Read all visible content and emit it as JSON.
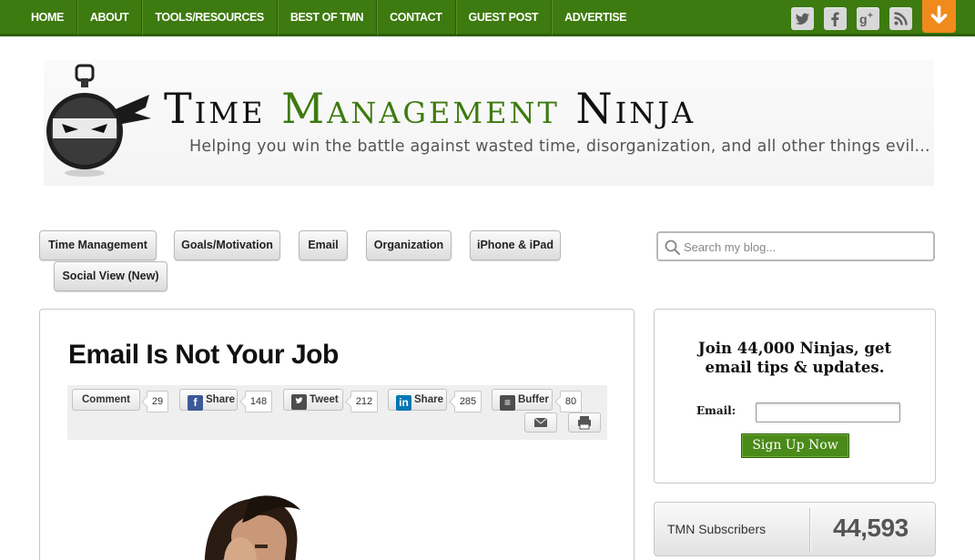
{
  "nav": {
    "links": [
      "HOME",
      "ABOUT",
      "TOOLS/RESOURCES",
      "BEST OF TMN",
      "CONTACT",
      "GUEST POST",
      "ADVERTISE"
    ],
    "social_icons": [
      "twitter-icon",
      "facebook-icon",
      "google-plus-icon",
      "rss-icon"
    ],
    "accent_color": "#3d7a0f",
    "arrow_color": "#f08a1c"
  },
  "header": {
    "title_part1": "Time ",
    "title_part2": "Management",
    "title_part3": " Ninja",
    "tagline": "Helping you win the battle against wasted time, disorganization, and all other things evil..."
  },
  "categories": [
    "Time Management",
    "Goals/Motivation",
    "Email",
    "Organization",
    "iPhone & iPad",
    "Social View (New)"
  ],
  "search": {
    "placeholder": "Search my blog..."
  },
  "article": {
    "title": "Email Is Not Your Job",
    "share": [
      {
        "label": "Comment",
        "count": "29"
      },
      {
        "label": "Share",
        "count": "148"
      },
      {
        "label": "Tweet",
        "count": "212"
      },
      {
        "label": "Share",
        "count": "285"
      },
      {
        "label": "Buffer",
        "count": "80"
      }
    ]
  },
  "signup": {
    "heading": "Join 44,000 Ninjas, get email tips & updates.",
    "email_label": "Email:",
    "button": "Sign Up Now"
  },
  "subscribers": {
    "label": "TMN Subscribers",
    "count": "44,593"
  }
}
